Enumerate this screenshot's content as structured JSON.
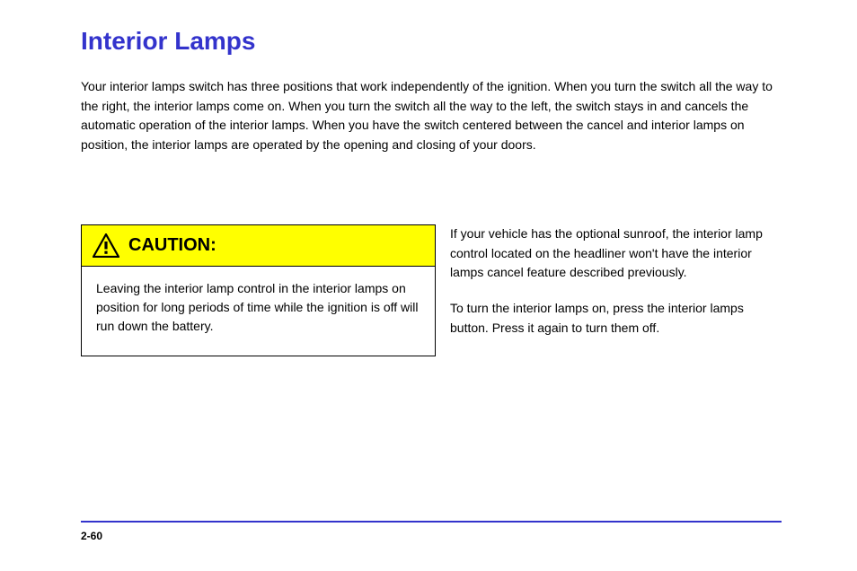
{
  "title": "Interior Lamps",
  "intro": "Your interior lamps switch has three positions that work independently of the ignition. When you turn the switch all the way to the right, the interior lamps come on. When you turn the switch all the way to the left, the switch stays in and cancels the automatic operation of the interior lamps. When you have the switch centered between the cancel and interior lamps on position, the interior lamps are operated by the opening and closing of your doors.",
  "caution": {
    "label": "CAUTION:",
    "body": "Leaving the interior lamp control in the interior lamps on position for long periods of time while the ignition is off will run down the battery."
  },
  "right_col": {
    "p1": "If your vehicle has the optional sunroof, the interior lamp control located on the headliner won't have the interior lamps cancel feature described previously.",
    "p2": "To turn the interior lamps on, press the interior lamps button. Press it again to turn them off."
  },
  "page_number": "2-60"
}
